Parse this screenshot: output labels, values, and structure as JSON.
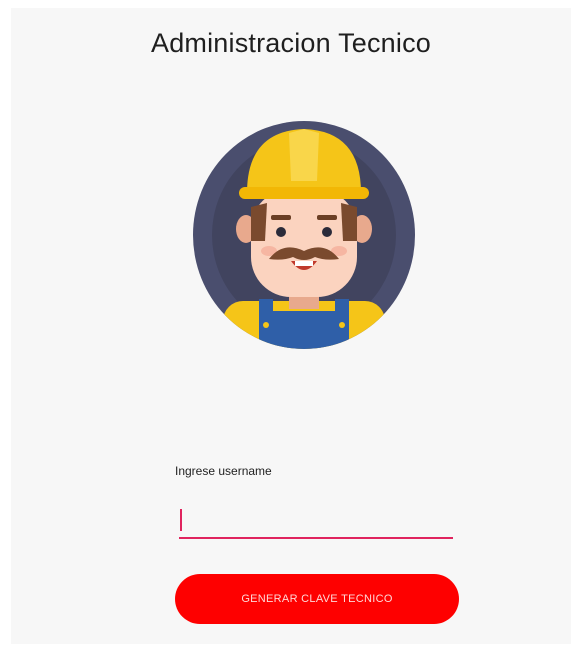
{
  "header": {
    "title": "Administracion Tecnico"
  },
  "avatar": {
    "icon": "worker-avatar-icon"
  },
  "form": {
    "username_label": "Ingrese username",
    "username_value": "",
    "submit_label": "GENERAR CLAVE TECNICO"
  },
  "colors": {
    "background": "#f7f7f7",
    "accent": "#e0245e",
    "button": "#fe0000",
    "helmet": "#f5c518",
    "avatar_ring": "#4a4e6e"
  }
}
